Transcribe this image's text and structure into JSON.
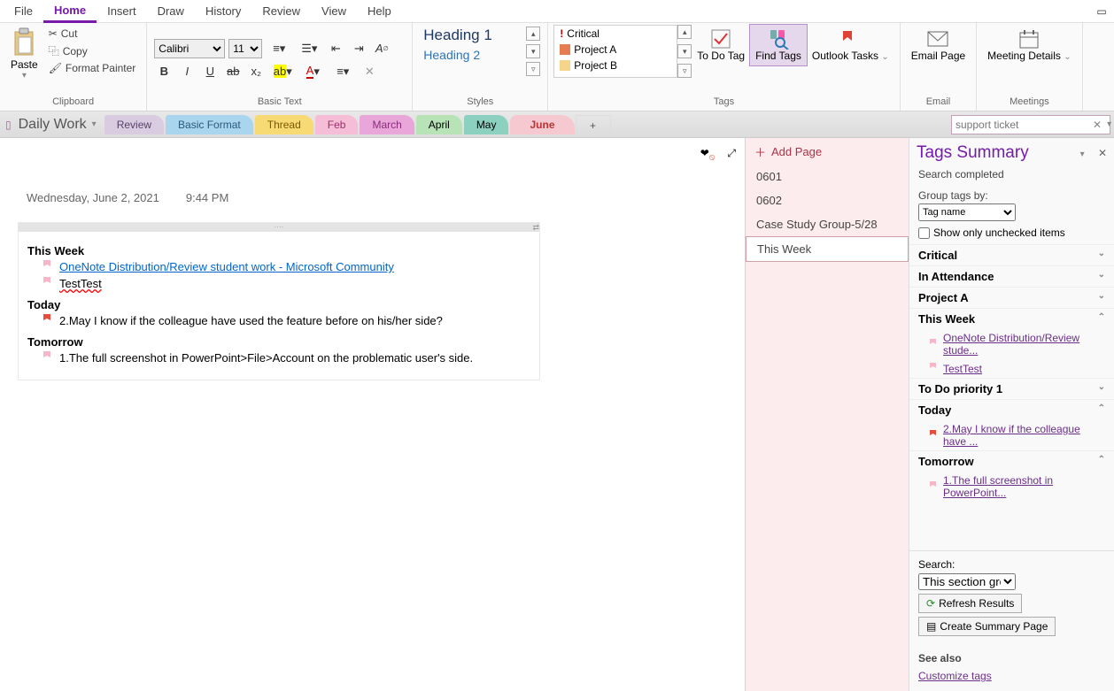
{
  "menu": {
    "file": "File",
    "home": "Home",
    "insert": "Insert",
    "draw": "Draw",
    "history": "History",
    "review": "Review",
    "view": "View",
    "help": "Help"
  },
  "ribbon": {
    "clipboard": {
      "label": "Clipboard",
      "paste": "Paste",
      "cut": "Cut",
      "copy": "Copy",
      "format_painter": "Format Painter"
    },
    "basic_text": {
      "label": "Basic Text",
      "font": "Calibri",
      "size": "11"
    },
    "styles": {
      "label": "Styles",
      "h1": "Heading 1",
      "h2": "Heading 2"
    },
    "tags": {
      "label": "Tags",
      "critical": "Critical",
      "project_a": "Project A",
      "project_b": "Project B",
      "todo": "To Do Tag",
      "find": "Find Tags",
      "outlook": "Outlook Tasks"
    },
    "email": {
      "label": "Email",
      "btn": "Email Page"
    },
    "meetings": {
      "label": "Meetings",
      "btn": "Meeting Details"
    }
  },
  "notebook": {
    "title": "Daily Work",
    "search": "support ticket"
  },
  "tabs": [
    "Review",
    "Basic Format",
    "Thread",
    "Feb",
    "March",
    "April",
    "May",
    "June"
  ],
  "page_meta": {
    "date": "Wednesday, June 2, 2021",
    "time": "9:44 PM"
  },
  "sections": {
    "this_week": {
      "title": "This Week",
      "line1": "OneNote Distribution/Review student work - Microsoft Community",
      "line2": "TestTest"
    },
    "today": {
      "title": "Today",
      "line1": "2.May I know if the colleague have used the feature before on his/her side?"
    },
    "tomorrow": {
      "title": "Tomorrow",
      "line1": "1.The full screenshot in PowerPoint>File>Account on the problematic user's side."
    }
  },
  "pages": {
    "add": "Add Page",
    "p1": "0601",
    "p2": "0602",
    "p3": "Case Study Group-5/28",
    "p4": "This Week"
  },
  "tagspane": {
    "title": "Tags Summary",
    "completed": "Search completed",
    "groupby_label": "Group tags by:",
    "groupby_value": "Tag name",
    "show_unchecked": "Show only unchecked items",
    "g_critical": "Critical",
    "g_attendance": "In Attendance",
    "g_projecta": "Project A",
    "g_thisweek": "This Week",
    "i_onenote": "OneNote Distribution/Review stude...",
    "i_testtest": "TestTest",
    "g_todo": "To Do priority 1",
    "g_today": "Today",
    "i_today": "2.May I know if the colleague have ...",
    "g_tomorrow": "Tomorrow",
    "i_tomorrow": "1.The full screenshot in PowerPoint...",
    "search_label": "Search:",
    "search_scope": "This section group",
    "refresh": "Refresh Results",
    "create": "Create Summary Page",
    "see_also": "See also",
    "customize": "Customize tags"
  }
}
